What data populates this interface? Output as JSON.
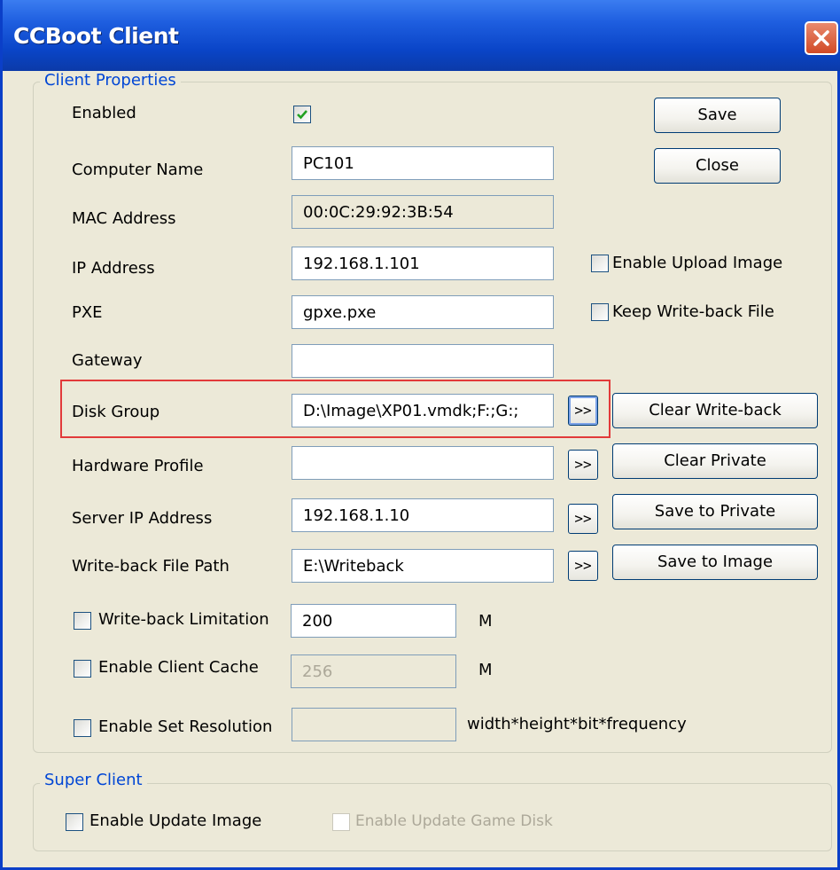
{
  "window": {
    "title": "CCBoot Client"
  },
  "client_properties": {
    "legend": "Client Properties",
    "enabled": {
      "label": "Enabled",
      "checked": true
    },
    "computer_name": {
      "label": "Computer Name",
      "value": "PC101"
    },
    "mac_address": {
      "label": "MAC Address",
      "value": "00:0C:29:92:3B:54"
    },
    "ip_address": {
      "label": "IP Address",
      "value": "192.168.1.101"
    },
    "pxe": {
      "label": "PXE",
      "value": "gpxe.pxe"
    },
    "gateway": {
      "label": "Gateway",
      "value": ""
    },
    "disk_group": {
      "label": "Disk Group",
      "value": "D:\\Image\\XP01.vmdk;F:;G:;"
    },
    "hardware_profile": {
      "label": "Hardware Profile",
      "value": ""
    },
    "server_ip": {
      "label": "Server IP Address",
      "value": "192.168.1.10"
    },
    "writeback_path": {
      "label": "Write-back File Path",
      "value": "E:\\Writeback"
    },
    "writeback_limitation": {
      "label": "Write-back Limitation",
      "checked": false,
      "value": "200",
      "unit": "M"
    },
    "client_cache": {
      "label": "Enable Client Cache",
      "checked": false,
      "value": "256",
      "unit": "M"
    },
    "set_resolution": {
      "label": "Enable Set Resolution",
      "checked": false,
      "value": "",
      "hint": "width*height*bit*frequency"
    },
    "browse_label": ">>"
  },
  "options": {
    "enable_upload_image": {
      "label": "Enable Upload Image",
      "checked": false
    },
    "keep_writeback_file": {
      "label": "Keep Write-back File",
      "checked": false
    }
  },
  "buttons": {
    "save": "Save",
    "close": "Close",
    "clear_writeback": "Clear Write-back",
    "clear_private": "Clear Private",
    "save_to_private": "Save to Private",
    "save_to_image": "Save to Image"
  },
  "super_client": {
    "legend": "Super Client",
    "enable_update_image": {
      "label": "Enable Update Image",
      "checked": false
    },
    "enable_update_game_disk": {
      "label": "Enable Update Game Disk",
      "checked": false,
      "disabled": true
    }
  },
  "colors": {
    "title_bar": "#0a45c8",
    "legend_text": "#0046d5",
    "highlight": "#e23a3a",
    "check": "#21a121"
  }
}
